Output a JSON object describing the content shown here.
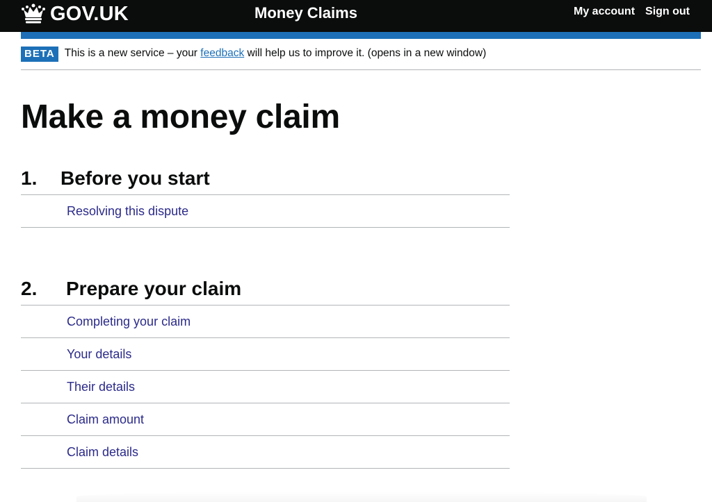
{
  "header": {
    "logo_text": "GOV.UK",
    "service_name": "Money Claims",
    "nav": {
      "my_account": "My account",
      "sign_out": "Sign out"
    }
  },
  "phase_banner": {
    "tag": "BETA",
    "text_before": "This is a new service – your ",
    "link": "feedback",
    "text_after": " will help us to improve it. (opens in a new window)"
  },
  "page_title": "Make a money claim",
  "sections": [
    {
      "number": "1.",
      "title": "Before you start",
      "tasks": [
        "Resolving this dispute"
      ]
    },
    {
      "number": "2.",
      "title": "Prepare your claim",
      "tasks": [
        "Completing your claim",
        "Your details",
        "Their details",
        "Claim amount",
        "Claim details"
      ]
    }
  ],
  "colors": {
    "header_bg": "#0b0c0c",
    "brand_blue": "#1d70b8",
    "link": "#2b2a8a",
    "text": "#0b0c0c",
    "border": "#b1b4b6"
  },
  "icons": {
    "logo": "crown-icon"
  }
}
